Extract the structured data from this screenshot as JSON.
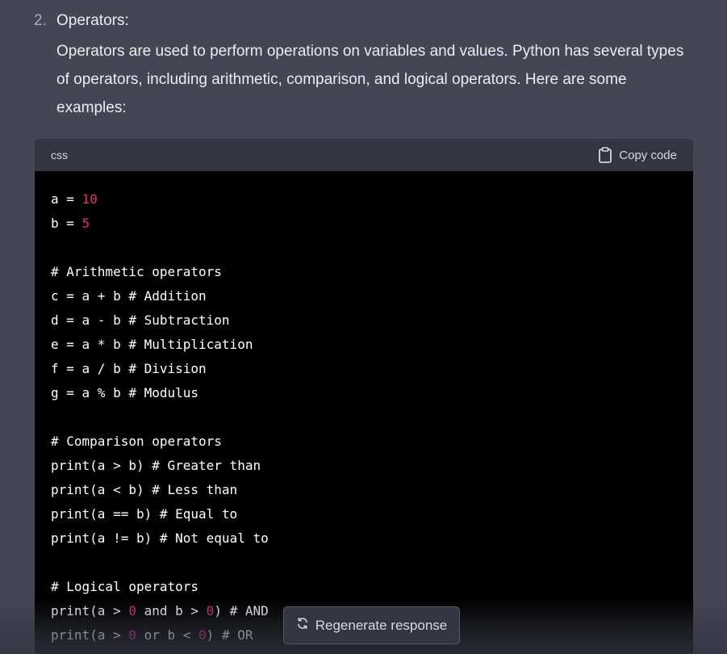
{
  "list_item": {
    "number": "2.",
    "heading": "Operators:",
    "paragraph": "Operators are used to perform operations on variables and values. Python has several types of operators, including arithmetic, comparison, and logical operators. Here are some examples:"
  },
  "code_block": {
    "language": "css",
    "copy_label": "Copy code",
    "lines": [
      [
        {
          "t": "a = "
        },
        {
          "t": "10",
          "k": "num"
        }
      ],
      [
        {
          "t": "b = "
        },
        {
          "t": "5",
          "k": "num"
        }
      ],
      [],
      [
        {
          "t": "# Arithmetic operators"
        }
      ],
      [
        {
          "t": "c = a + b # Addition"
        }
      ],
      [
        {
          "t": "d = a - b # Subtraction"
        }
      ],
      [
        {
          "t": "e = a * b # Multiplication"
        }
      ],
      [
        {
          "t": "f = a / b # Division"
        }
      ],
      [
        {
          "t": "g = a % b # Modulus"
        }
      ],
      [],
      [
        {
          "t": "# Comparison operators"
        }
      ],
      [
        {
          "t": "print(a > b) # Greater than"
        }
      ],
      [
        {
          "t": "print(a < b) # Less than"
        }
      ],
      [
        {
          "t": "print(a == b) # Equal to"
        }
      ],
      [
        {
          "t": "print(a != b) # Not equal to"
        }
      ],
      [],
      [
        {
          "t": "# Logical operators"
        }
      ],
      [
        {
          "t": "print(a > "
        },
        {
          "t": "0",
          "k": "num"
        },
        {
          "t": " and b > "
        },
        {
          "t": "0",
          "k": "num"
        },
        {
          "t": ") # AND"
        }
      ],
      [
        {
          "t": "print(a > "
        },
        {
          "t": "0",
          "k": "num"
        },
        {
          "t": " or b < "
        },
        {
          "t": "0",
          "k": "num"
        },
        {
          "t": ") # OR"
        }
      ]
    ]
  },
  "regenerate": {
    "label": "Regenerate response",
    "icon": "refresh-icon"
  },
  "colors": {
    "background": "#444654",
    "code_background": "#000000",
    "code_header": "#343541",
    "number_literal": "#df3079"
  }
}
